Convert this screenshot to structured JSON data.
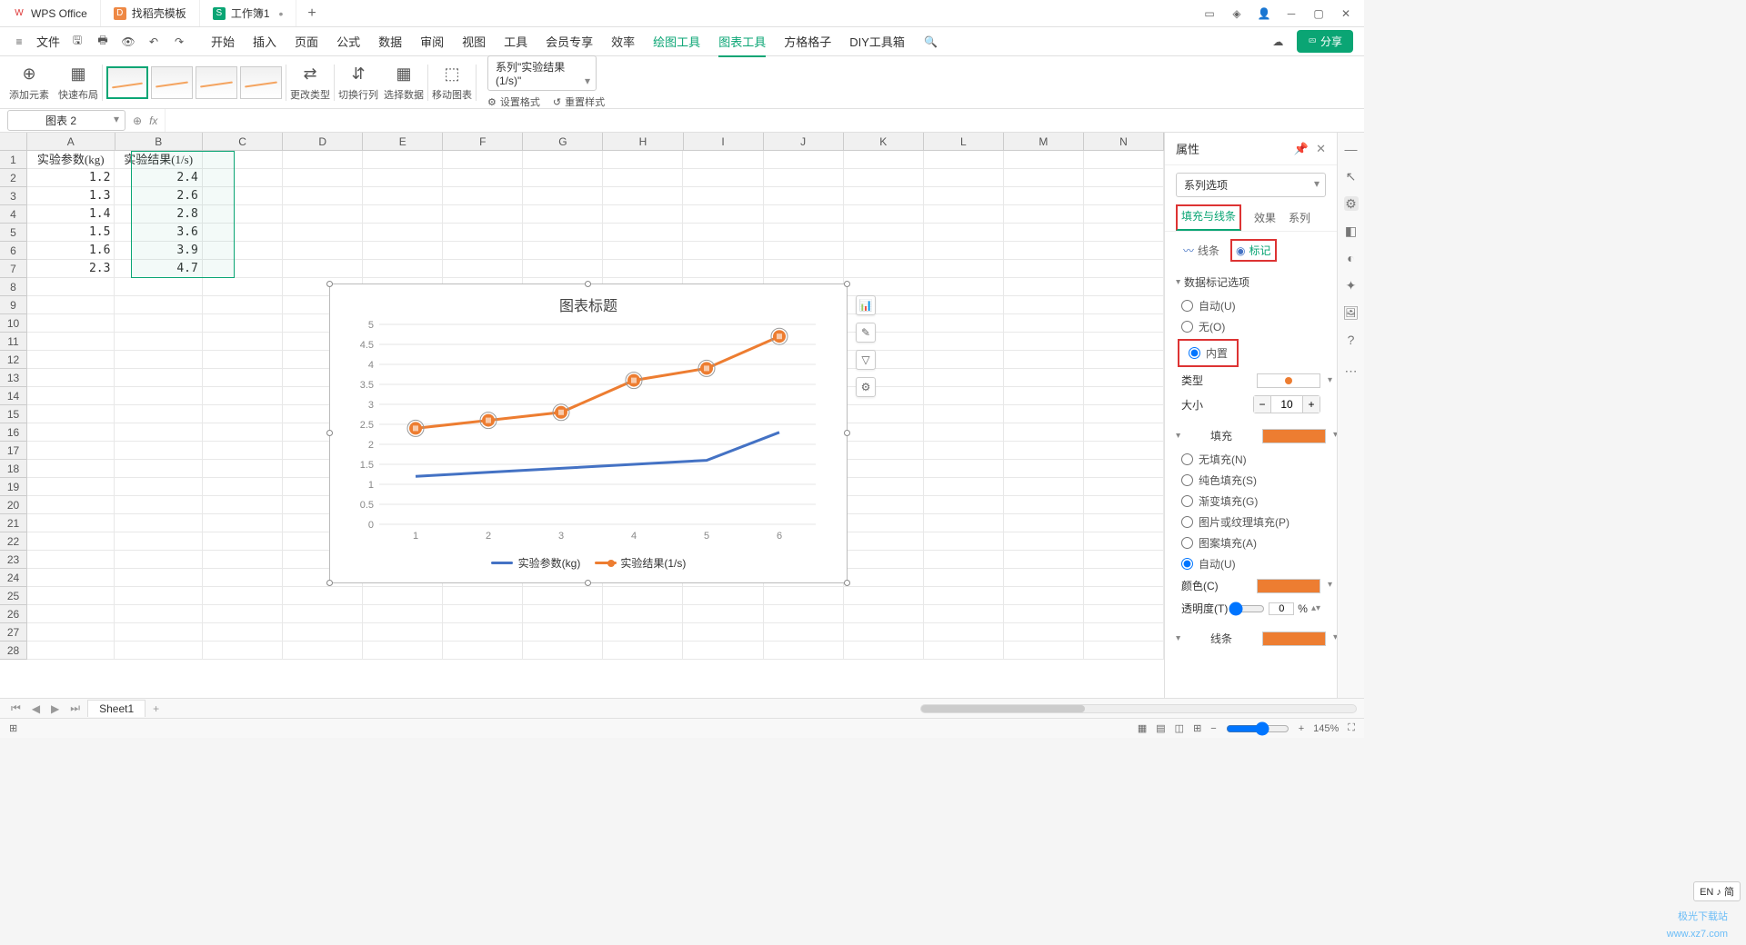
{
  "titlebar": {
    "tab1": "WPS Office",
    "tab2": "找稻壳模板",
    "tab3": "工作簿1"
  },
  "menubar": {
    "file": "文件",
    "items": [
      "开始",
      "插入",
      "页面",
      "公式",
      "数据",
      "审阅",
      "视图",
      "工具",
      "会员专享",
      "效率",
      "绘图工具",
      "图表工具",
      "方格格子",
      "DIY工具箱"
    ],
    "share": "分享"
  },
  "ribbon": {
    "add_element": "添加元素",
    "quick_layout": "快速布局",
    "change_type": "更改类型",
    "switch_rc": "切换行列",
    "select_data": "选择数据",
    "move_chart": "移动图表",
    "series_select": "系列\"实验结果(1/s)\"",
    "set_format": "设置格式",
    "reset_style": "重置样式"
  },
  "formula": {
    "name_box": "图表 2",
    "fx": "fx"
  },
  "grid": {
    "cols": [
      "A",
      "B",
      "C",
      "D",
      "E",
      "F",
      "G",
      "H",
      "I",
      "J",
      "K",
      "L",
      "M",
      "N"
    ],
    "rows": 28,
    "a_header": "实验参数(kg)",
    "b_header": "实验结果(1/s)",
    "data": [
      [
        "1.2",
        "2.4"
      ],
      [
        "1.3",
        "2.6"
      ],
      [
        "1.4",
        "2.8"
      ],
      [
        "1.5",
        "3.6"
      ],
      [
        "1.6",
        "3.9"
      ],
      [
        "2.3",
        "4.7"
      ]
    ]
  },
  "chart": {
    "title": "图表标题",
    "legend1": "实验参数(kg)",
    "legend2": "实验结果(1/s)",
    "color1": "#4472c4",
    "color2": "#ed7d31"
  },
  "chart_data": {
    "type": "line",
    "title": "图表标题",
    "categories": [
      "1",
      "2",
      "3",
      "4",
      "5",
      "6"
    ],
    "series": [
      {
        "name": "实验参数(kg)",
        "values": [
          1.2,
          1.3,
          1.4,
          1.5,
          1.6,
          2.3
        ],
        "color": "#4472c4",
        "markers": false
      },
      {
        "name": "实验结果(1/s)",
        "values": [
          2.4,
          2.6,
          2.8,
          3.6,
          3.9,
          4.7
        ],
        "color": "#ed7d31",
        "markers": true
      }
    ],
    "ylim": [
      0,
      5
    ],
    "yticks": [
      0,
      0.5,
      1,
      1.5,
      2,
      2.5,
      3,
      3.5,
      4,
      4.5,
      5
    ],
    "xlabel": "",
    "ylabel": ""
  },
  "props": {
    "title": "属性",
    "series_options": "系列选项",
    "tab_fill_line": "填充与线条",
    "tab_effect": "效果",
    "tab_series": "系列",
    "sub_line": "线条",
    "sub_marker": "标记",
    "marker_section": "数据标记选项",
    "auto": "自动(U)",
    "none": "无(O)",
    "builtin": "内置",
    "type": "类型",
    "size": "大小",
    "size_value": "10",
    "fill_section": "填充",
    "no_fill": "无填充(N)",
    "solid_fill": "纯色填充(S)",
    "gradient_fill": "渐变填充(G)",
    "pic_fill": "图片或纹理填充(P)",
    "pattern_fill": "图案填充(A)",
    "auto_fill": "自动(U)",
    "color": "颜色(C)",
    "transparency": "透明度(T)",
    "transparency_value": "0",
    "pct": "%",
    "line_section": "线条"
  },
  "sheet_tabs": {
    "sheet1": "Sheet1"
  },
  "status": {
    "zoom": "145%",
    "ime": "EN ♪ 简"
  },
  "watermark1": "极光下载站",
  "watermark2": "www.xz7.com"
}
